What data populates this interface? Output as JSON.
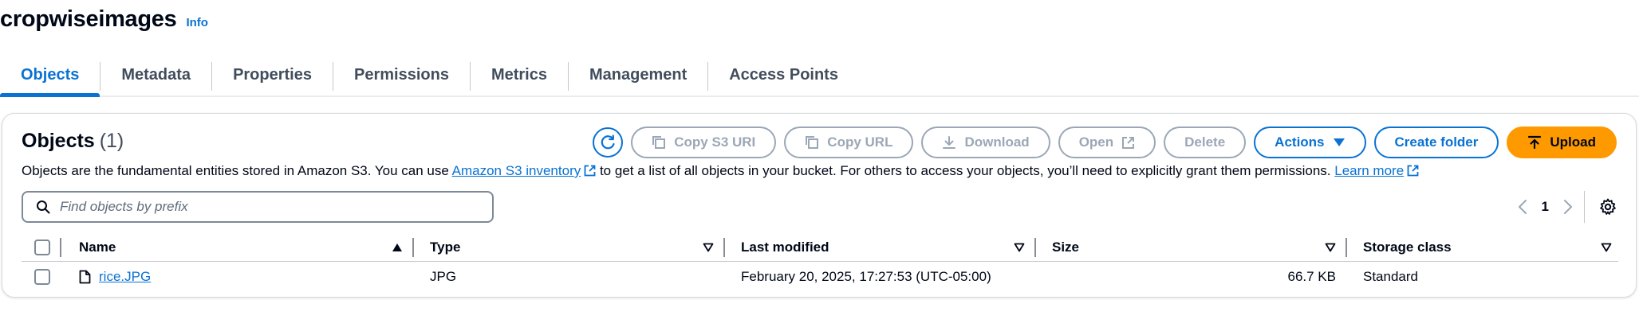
{
  "bucket": {
    "name": "cropwiseimages",
    "info_label": "Info"
  },
  "tabs": [
    {
      "label": "Objects",
      "active": true
    },
    {
      "label": "Metadata"
    },
    {
      "label": "Properties"
    },
    {
      "label": "Permissions"
    },
    {
      "label": "Metrics"
    },
    {
      "label": "Management"
    },
    {
      "label": "Access Points"
    }
  ],
  "objects_panel": {
    "heading": "Objects",
    "count": "(1)",
    "description_prefix": "Objects are the fundamental entities stored in Amazon S3. You can use ",
    "inventory_link": "Amazon S3 inventory",
    "description_middle": " to get a list of all objects in your bucket. For others to access your objects, you’ll need to explicitly grant them permissions. ",
    "learn_more": "Learn more"
  },
  "toolbar": {
    "copy_s3_uri": "Copy S3 URI",
    "copy_url": "Copy URL",
    "download": "Download",
    "open": "Open",
    "delete": "Delete",
    "actions": "Actions",
    "create_folder": "Create folder",
    "upload": "Upload"
  },
  "search": {
    "placeholder": "Find objects by prefix"
  },
  "pagination": {
    "current_page": "1"
  },
  "table": {
    "columns": {
      "name": "Name",
      "type": "Type",
      "last_modified": "Last modified",
      "size": "Size",
      "storage_class": "Storage class"
    },
    "rows": [
      {
        "name": "rice.JPG",
        "type": "JPG",
        "last_modified": "February 20, 2025, 17:27:53 (UTC-05:00)",
        "size": "66.7 KB",
        "storage_class": "Standard"
      }
    ]
  },
  "colors": {
    "link": "#0972d3",
    "upload": "#ff9900",
    "disabled": "#9ba7b6"
  }
}
